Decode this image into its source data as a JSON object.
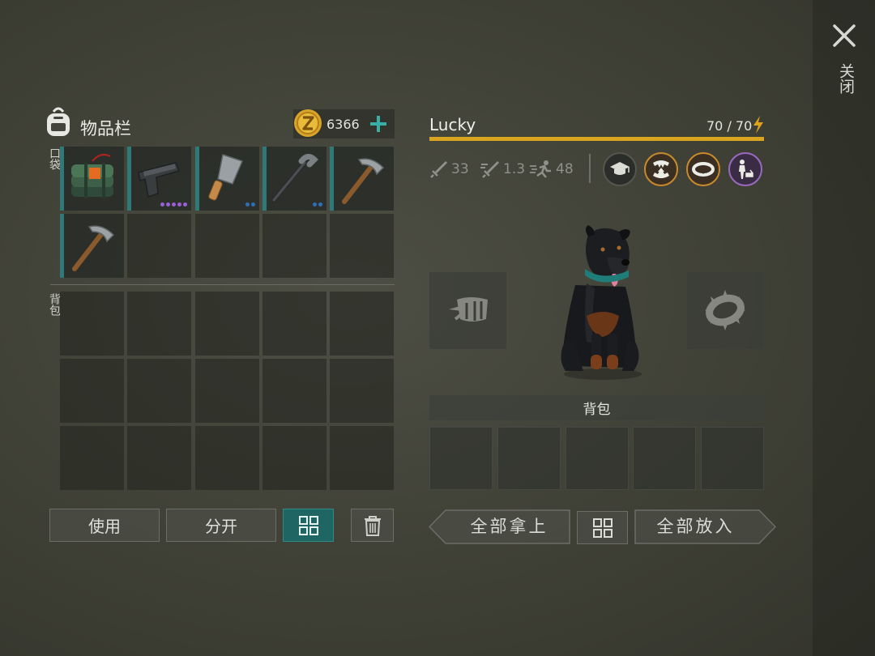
{
  "close_label": "关闭",
  "inventory": {
    "title": "物品栏",
    "coins": "6366",
    "pocket_label": "口袋",
    "backpack_label": "背包",
    "pocket_items": [
      {
        "icon": "explosive-bundle-icon",
        "dots": []
      },
      {
        "icon": "pistol-icon",
        "dots": [
          "#9b5fd6",
          "#9b5fd6",
          "#9b5fd6",
          "#9b5fd6",
          "#9b5fd6"
        ]
      },
      {
        "icon": "cleaver-icon",
        "dots": [
          "#2b2f2c",
          "#2e6fb7",
          "#2e6fb7"
        ]
      },
      {
        "icon": "crowbar-icon",
        "dots": [
          "#2e6fb7",
          "#2e6fb7"
        ]
      },
      {
        "icon": "pickaxe-icon",
        "dots": []
      },
      {
        "icon": "pickaxe-icon",
        "dots": []
      }
    ],
    "use_button": "使用",
    "split_button": "分开"
  },
  "pet": {
    "name": "Lucky",
    "energy": "70 / 70",
    "energy_fraction": 1.0,
    "stats": {
      "attack": "33",
      "speed_mult": "1.3",
      "run": "48"
    },
    "skills": [
      "graduation-cap-icon",
      "fangs-upgrade-icon",
      "collar-icon",
      "trainer-icon"
    ],
    "backpack_label": "背包",
    "take_all": "全部拿上",
    "put_all": "全部放入"
  },
  "colors": {
    "accent_teal": "#2f7a78",
    "energy_gold": "#d9a520",
    "coin_gold": "#d8a42a"
  }
}
